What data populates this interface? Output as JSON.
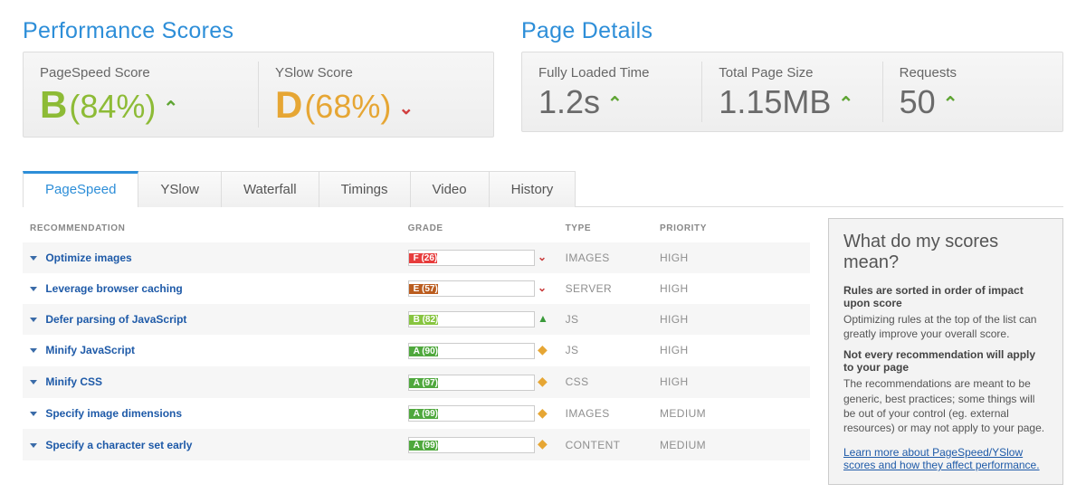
{
  "sections": {
    "scores": {
      "title": "Performance Scores"
    },
    "details": {
      "title": "Page Details"
    }
  },
  "scores": [
    {
      "label": "PageSpeed Score",
      "grade": "B",
      "pct": "(84%)",
      "trend": "up",
      "gradeClass": "grade-B"
    },
    {
      "label": "YSlow Score",
      "grade": "D",
      "pct": "(68%)",
      "trend": "down",
      "gradeClass": "grade-D"
    }
  ],
  "details": [
    {
      "label": "Fully Loaded Time",
      "value": "1.2s",
      "trend": "up"
    },
    {
      "label": "Total Page Size",
      "value": "1.15MB",
      "trend": "up"
    },
    {
      "label": "Requests",
      "value": "50",
      "trend": "up"
    }
  ],
  "tabs": [
    {
      "label": "PageSpeed",
      "active": true
    },
    {
      "label": "YSlow"
    },
    {
      "label": "Waterfall"
    },
    {
      "label": "Timings"
    },
    {
      "label": "Video"
    },
    {
      "label": "History"
    }
  ],
  "tableHeaders": {
    "rec": "RECOMMENDATION",
    "grade": "GRADE",
    "type": "TYPE",
    "priority": "PRIORITY"
  },
  "rows": [
    {
      "name": "Optimize images",
      "grade": "F (26)",
      "pct": 26,
      "color": "#e73c3c",
      "trend": "down",
      "type": "IMAGES",
      "priority": "HIGH"
    },
    {
      "name": "Leverage browser caching",
      "grade": "E (57)",
      "pct": 57,
      "color": "#bb5d1f",
      "trend": "down",
      "type": "SERVER",
      "priority": "HIGH"
    },
    {
      "name": "Defer parsing of JavaScript",
      "grade": "B (82)",
      "pct": 82,
      "color": "#87c540",
      "trend": "up",
      "type": "JS",
      "priority": "HIGH"
    },
    {
      "name": "Minify JavaScript",
      "grade": "A (90)",
      "pct": 90,
      "color": "#4fa83d",
      "trend": "neu",
      "type": "JS",
      "priority": "HIGH"
    },
    {
      "name": "Minify CSS",
      "grade": "A (97)",
      "pct": 97,
      "color": "#4fa83d",
      "trend": "neu",
      "type": "CSS",
      "priority": "HIGH"
    },
    {
      "name": "Specify image dimensions",
      "grade": "A (99)",
      "pct": 99,
      "color": "#4fa83d",
      "trend": "neu",
      "type": "IMAGES",
      "priority": "MEDIUM"
    },
    {
      "name": "Specify a character set early",
      "grade": "A (99)",
      "pct": 99,
      "color": "#4fa83d",
      "trend": "neu",
      "type": "CONTENT",
      "priority": "MEDIUM"
    }
  ],
  "sidebar": {
    "title": "What do my scores mean?",
    "h1": "Rules are sorted in order of impact upon score",
    "p1": "Optimizing rules at the top of the list can greatly improve your overall score.",
    "h2": "Not every recommendation will apply to your page",
    "p2": "The recommendations are meant to be generic, best practices; some things will be out of your control (eg. external resources) or may not apply to your page.",
    "link": "Learn more about PageSpeed/YSlow scores and how they affect performance."
  },
  "trendGlyph": {
    "up": "⌃",
    "down": "⌄",
    "neu": "◆"
  }
}
